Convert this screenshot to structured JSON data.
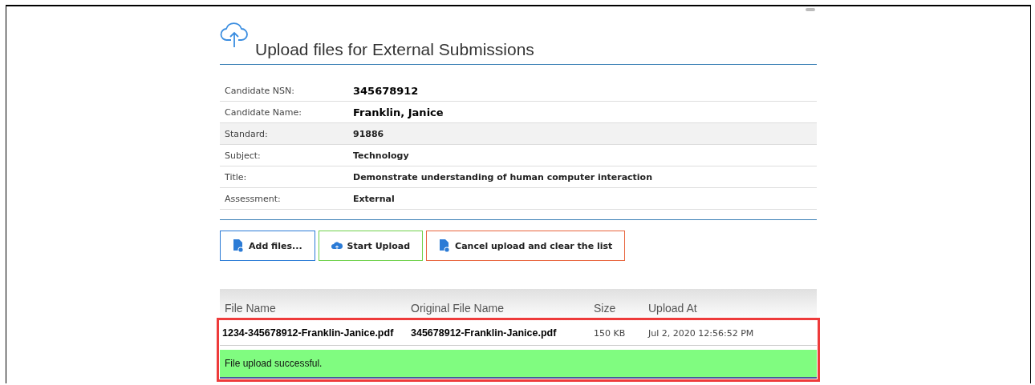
{
  "title": "Upload files for External Submissions",
  "details": [
    {
      "label": "Candidate NSN:",
      "value": "345678912",
      "kind": "large",
      "highlighted": false
    },
    {
      "label": "Candidate Name:",
      "value": "Franklin, Janice",
      "kind": "large",
      "highlighted": false
    },
    {
      "label": "Standard:",
      "value": "91886",
      "kind": "normal",
      "highlighted": true
    },
    {
      "label": "Subject:",
      "value": "Technology",
      "kind": "normal",
      "highlighted": false
    },
    {
      "label": "Title:",
      "value": "Demonstrate understanding of human computer interaction",
      "kind": "normal",
      "highlighted": false
    },
    {
      "label": "Assessment:",
      "value": "External",
      "kind": "normal",
      "highlighted": false
    }
  ],
  "buttons": [
    {
      "label": "Add files...",
      "kind": "add"
    },
    {
      "label": "Start Upload",
      "kind": "start"
    },
    {
      "label": "Cancel upload and clear the list",
      "kind": "cancel"
    }
  ],
  "table": {
    "columns": [
      "File Name",
      "Original File Name",
      "Size",
      "Upload At"
    ],
    "rows": [
      {
        "file_name": "1234-345678912-Franklin-Janice.pdf",
        "original_file_name": "345678912-Franklin-Janice.pdf",
        "size": "150 KB",
        "upload_at": "Jul 2, 2020 12:56:52 PM",
        "message": "File upload successful.",
        "highlighted": true
      }
    ]
  }
}
